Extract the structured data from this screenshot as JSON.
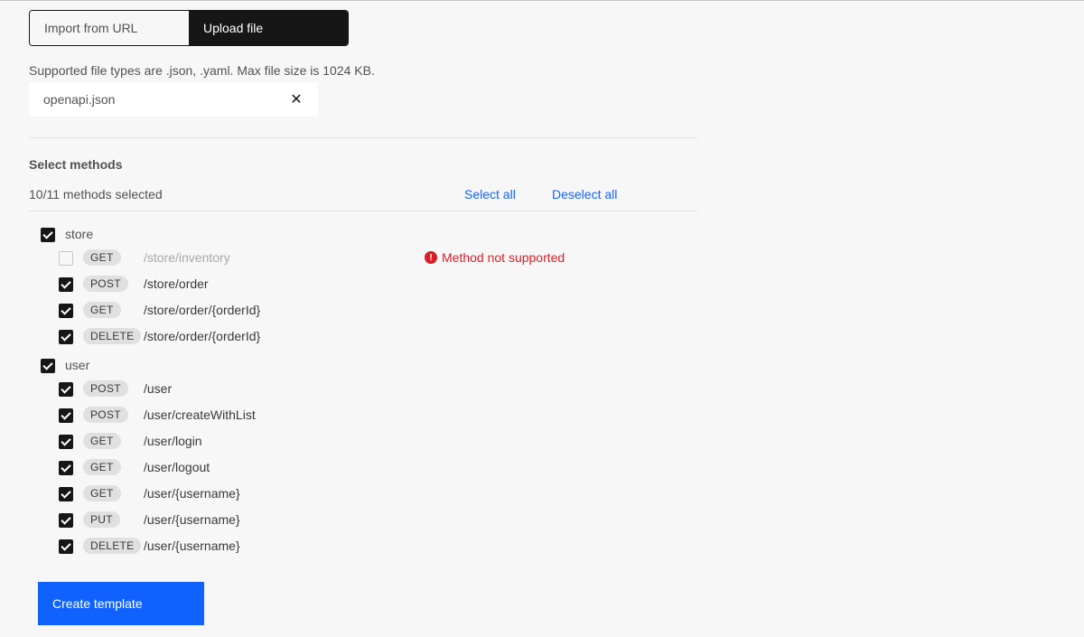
{
  "import_toggle": {
    "options": [
      {
        "label": "Import from URL",
        "active": false
      },
      {
        "label": "Upload file",
        "active": true
      }
    ]
  },
  "upload": {
    "helper_text": "Supported file types are .json, .yaml. Max file size is 1024 KB.",
    "file_name": "openapi.json",
    "remove_icon": "close-icon"
  },
  "methods": {
    "title": "Select methods",
    "count_text": "10/11 methods selected",
    "select_all_label": "Select all",
    "deselect_all_label": "Deselect all",
    "groups": [
      {
        "name": "store",
        "checked": true,
        "items": [
          {
            "method": "GET",
            "path": "/store/inventory",
            "checked": false,
            "disabled": true,
            "warning": "Method not supported"
          },
          {
            "method": "POST",
            "path": "/store/order",
            "checked": true
          },
          {
            "method": "GET",
            "path": "/store/order/{orderId}",
            "checked": true
          },
          {
            "method": "DELETE",
            "path": "/store/order/{orderId}",
            "checked": true
          }
        ]
      },
      {
        "name": "user",
        "checked": true,
        "items": [
          {
            "method": "POST",
            "path": "/user",
            "checked": true
          },
          {
            "method": "POST",
            "path": "/user/createWithList",
            "checked": true
          },
          {
            "method": "GET",
            "path": "/user/login",
            "checked": true
          },
          {
            "method": "GET",
            "path": "/user/logout",
            "checked": true
          },
          {
            "method": "GET",
            "path": "/user/{username}",
            "checked": true
          },
          {
            "method": "PUT",
            "path": "/user/{username}",
            "checked": true
          },
          {
            "method": "DELETE",
            "path": "/user/{username}",
            "checked": true
          }
        ]
      }
    ]
  },
  "actions": {
    "create_label": "Create template"
  },
  "colors": {
    "primary": "#0f62fe",
    "error": "#da1e28",
    "dark": "#161616"
  }
}
